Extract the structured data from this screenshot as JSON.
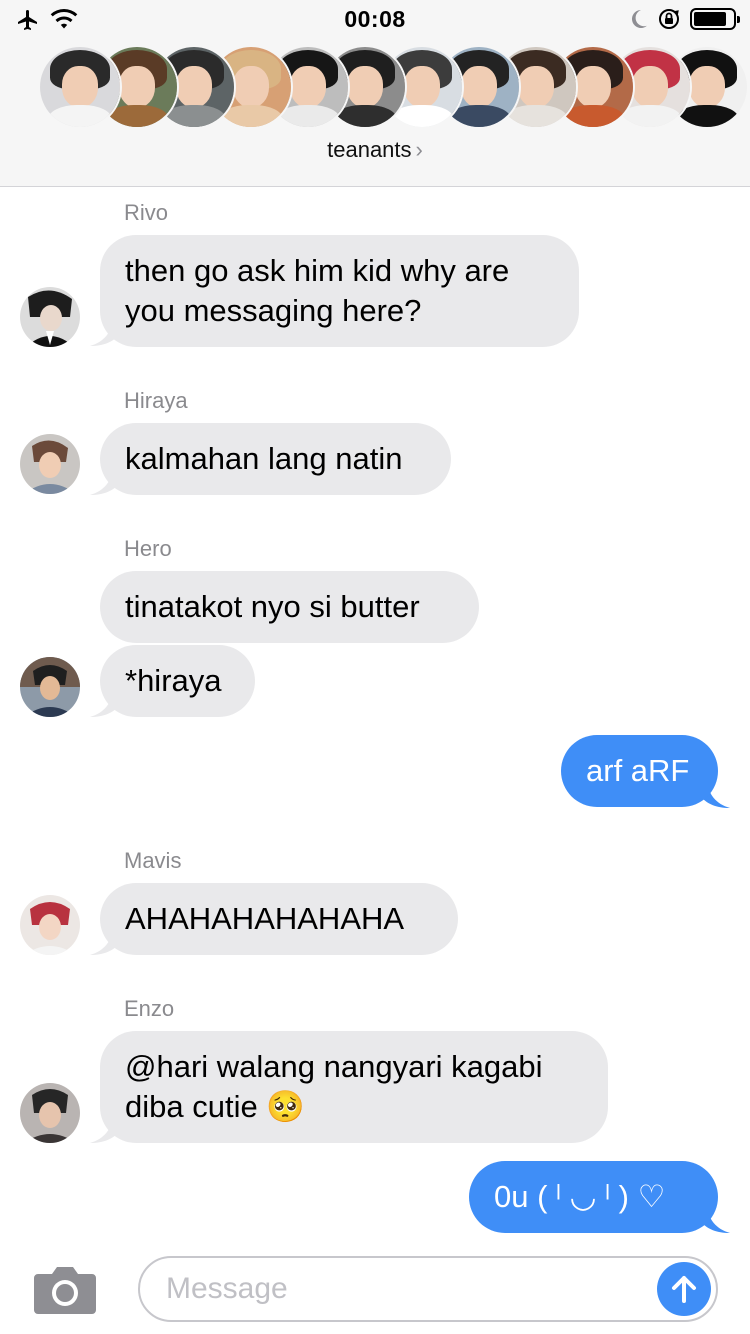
{
  "status_bar": {
    "time": "00:08",
    "airplane_icon": "airplane-icon",
    "wifi_icon": "wifi-icon",
    "moon_icon": "moon-icon",
    "orientation_lock_icon": "orientation-lock-icon",
    "battery_icon": "battery-icon",
    "battery_level": 0.85
  },
  "header": {
    "group_name": "teanants",
    "chevron": "›",
    "avatar_count": 12
  },
  "messages": [
    {
      "sender": "Rivo",
      "lines": [
        "then go ask him kid why are",
        "you messaging here?"
      ],
      "direction": "in"
    },
    {
      "sender": "Hiraya",
      "lines": [
        "kalmahan lang natin"
      ],
      "direction": "in"
    },
    {
      "sender": "Hero",
      "lines": [
        "tinatakot nyo si butter"
      ],
      "direction": "in"
    },
    {
      "sender": "",
      "lines": [
        "*hiraya"
      ],
      "direction": "in"
    },
    {
      "sender": "",
      "lines": [
        "arf aRF"
      ],
      "direction": "out"
    },
    {
      "sender": "Mavis",
      "lines": [
        "AHAHAHAHAHAHA"
      ],
      "direction": "in"
    },
    {
      "sender": "Enzo",
      "lines": [
        "@hari walang nangyari kagabi",
        "diba cutie 🥺"
      ],
      "direction": "in"
    },
    {
      "sender": "",
      "lines": [
        "0u ( ˡ ◡ ˡ ) ♡"
      ],
      "direction": "out"
    }
  ],
  "input_bar": {
    "camera_icon": "camera-icon",
    "placeholder": "Message",
    "value": "",
    "send_icon": "arrow-up-icon"
  },
  "colors": {
    "incoming_bubble": "#e9e9eb",
    "outgoing_bubble": "#3f8ef7",
    "header_bg": "#f6f6f6",
    "sender_text": "#8a8a8e"
  }
}
